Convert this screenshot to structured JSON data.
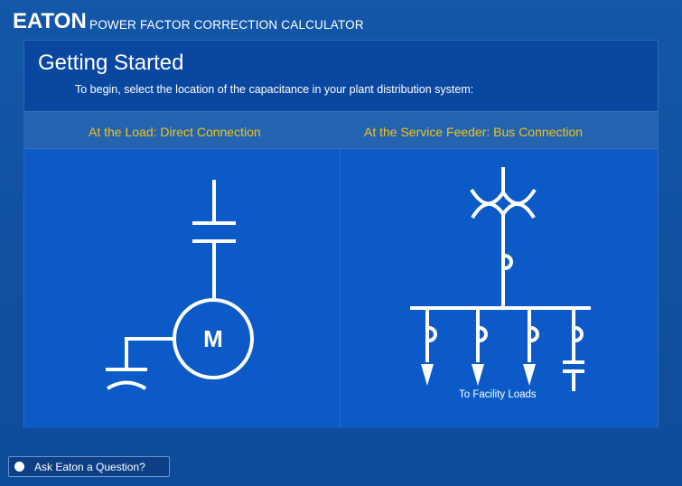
{
  "header": {
    "brand": "EATON",
    "app_title": "POWER FACTOR CORRECTION CALCULATOR"
  },
  "main": {
    "title": "Getting Started",
    "subtitle": "To begin, select the location of the capacitance in your plant distribution system:",
    "options": [
      {
        "label": "At the Load: Direct Connection",
        "diagram_text": "M"
      },
      {
        "label": "At the Service Feeder: Bus Connection",
        "diagram_text": "To Facility Loads"
      }
    ]
  },
  "footer": {
    "ask_label": "Ask Eaton a Question?"
  },
  "colors": {
    "background": "#0f4f9e",
    "panel": "#0a47a0",
    "choice": "#0b5ac8",
    "option_label": "#f0c419",
    "line": "#ffffff"
  }
}
